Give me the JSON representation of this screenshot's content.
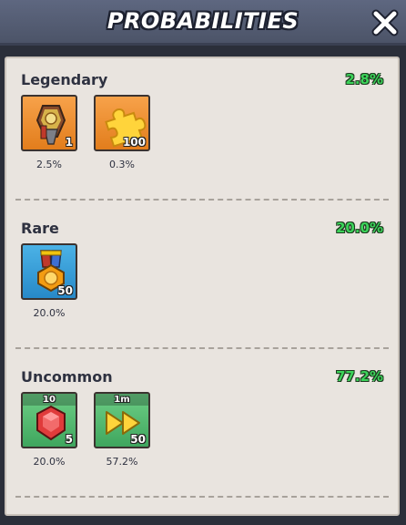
{
  "header": {
    "title": "PROBABILITIES",
    "close_icon": "close-icon"
  },
  "sections": [
    {
      "name": "Legendary",
      "percent": "2.8%",
      "items": [
        {
          "icon": "legendary-shard-icon",
          "quantity": "1",
          "chance": "2.5%"
        },
        {
          "icon": "puzzle-piece-icon",
          "quantity": "100",
          "chance": "0.3%"
        }
      ]
    },
    {
      "name": "Rare",
      "percent": "20.0%",
      "items": [
        {
          "icon": "medal-icon",
          "quantity": "50",
          "chance": "20.0%"
        }
      ]
    },
    {
      "name": "Uncommon",
      "percent": "77.2%",
      "items": [
        {
          "icon": "red-gem-icon",
          "top_label": "10",
          "quantity": "5",
          "chance": "20.0%"
        },
        {
          "icon": "fast-forward-icon",
          "top_label": "1m",
          "quantity": "50",
          "chance": "57.2%"
        }
      ]
    }
  ],
  "colors": {
    "percent_green": "#3cd35a",
    "panel": "#e9e4df",
    "header": "#545c72"
  }
}
